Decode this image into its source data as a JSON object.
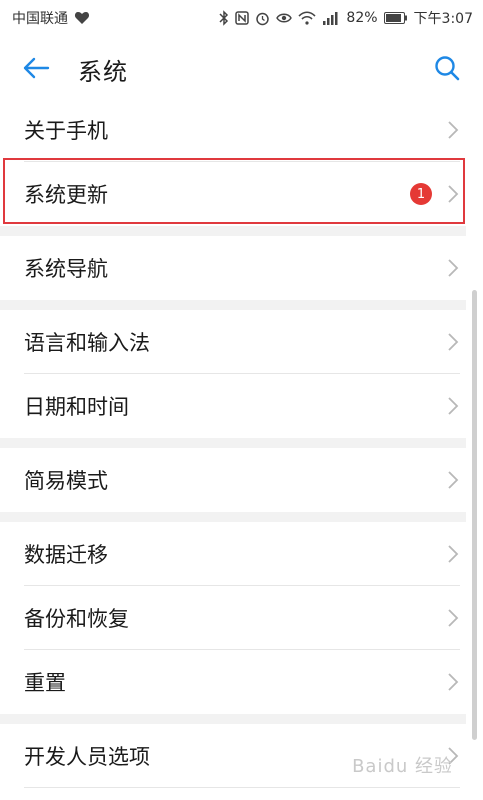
{
  "status_bar": {
    "carrier": "中国联通",
    "battery": "82%",
    "time": "下午3:07",
    "icons": [
      "heart-icon",
      "bluetooth-icon",
      "nfc-icon",
      "alarm-icon",
      "eye-icon",
      "wifi-icon",
      "signal-icon",
      "battery-icon"
    ]
  },
  "app_bar": {
    "title": "系统"
  },
  "groups": [
    {
      "items": [
        {
          "label": "关于手机"
        },
        {
          "label": "系统更新",
          "badge": "1"
        }
      ]
    },
    {
      "items": [
        {
          "label": "系统导航"
        }
      ]
    },
    {
      "items": [
        {
          "label": "语言和输入法"
        },
        {
          "label": "日期和时间"
        }
      ]
    },
    {
      "items": [
        {
          "label": "简易模式"
        }
      ]
    },
    {
      "items": [
        {
          "label": "数据迁移"
        },
        {
          "label": "备份和恢复"
        },
        {
          "label": "重置"
        }
      ]
    },
    {
      "items": [
        {
          "label": "开发人员选项"
        }
      ]
    }
  ],
  "watermark": "Baidu 经验",
  "colors": {
    "accent": "#1e88e5",
    "badge": "#e53935",
    "highlight_border": "#e0393e",
    "group_gap": "#f2f2f2"
  }
}
